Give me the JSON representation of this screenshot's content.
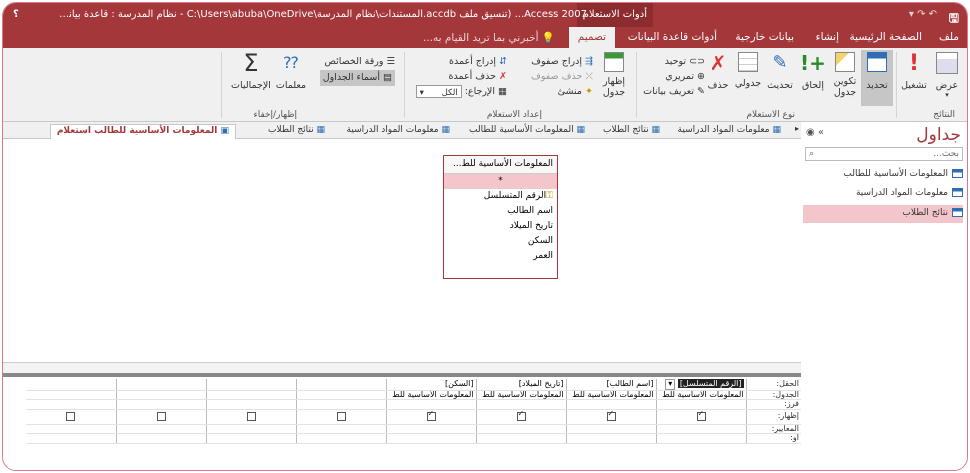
{
  "titlebar": {
    "app_title": "Access 2007... (تنسيق ملف accdb.المستندات\\نظام المدرسة\\C:\\Users\\abuba\\OneDrive - نظام المدرسة : قاعدة بيانات",
    "context_label": "أدوات الاستعلام"
  },
  "tabs": [
    "ملف",
    "الصفحة الرئيسية",
    "إنشاء",
    "بيانات خارجية",
    "أدوات قاعدة البيانات",
    "تصميم"
  ],
  "tell_me": "أخبرني بما تريد القيام به...",
  "ribbon": {
    "results_group": "النتائج",
    "run": "تشغيل",
    "view": "عرض",
    "select": "تحديد",
    "make_table": "تكوين جدول",
    "append": "إلحاق",
    "update": "تحديث",
    "crosstab": "جدولي",
    "delete": "حذف",
    "query_type_group": "نوع الاستعلام",
    "union": "توحيد",
    "pass_through": "تمريري",
    "data_definition": "تعريف بيانات",
    "show_table": "إظهار جدول",
    "setup_group": "إعداد الاستعلام",
    "insert_rows": "إدراج صفوف",
    "delete_rows": "حذف صفوف",
    "builder": "منشئ",
    "insert_columns": "إدراج أعمدة",
    "delete_columns": "حذف أعمدة",
    "return_label": "الإرجاع:",
    "return_value": "الكل",
    "showhide_group": "إظهار/إخفاء",
    "totals": "الإجماليات",
    "parameters": "معلمات",
    "property_sheet": "ورقة الخصائص",
    "table_names": "أسماء الجداول"
  },
  "nav": {
    "header": "جداول",
    "search_placeholder": "بحث...",
    "items": [
      "المعلومات الأساسية للطالب",
      "معلومات المواد الدراسية",
      "نتائج الطلاب"
    ]
  },
  "doc_tabs": [
    "المعلومات الأساسية للطالب استعلام",
    "نتائج الطلاب",
    "معلومات المواد الدراسية",
    "المعلومات الأساسية للطالب",
    "نتائج الطلاب",
    "معلومات المواد الدراسية"
  ],
  "table_box": {
    "title": "المعلومات الأساسية للط...",
    "star": "*",
    "fields": [
      "الرقم المتسلسل",
      "اسم الطالب",
      "تاريخ الميلاد",
      "السكن",
      "العمر"
    ]
  },
  "grid": {
    "row_labels": [
      "الحقل:",
      "الجدول:",
      "فرز:",
      "إظهار:",
      "المعايير:",
      "أو:"
    ],
    "fields": [
      "[الرقم المتسلسل]",
      "[اسم الطالب]",
      "[تاريخ الميلاد]",
      "[السكن]",
      "",
      "",
      "",
      ""
    ],
    "tables": [
      "المعلومات الأساسية للط",
      "المعلومات الأساسية للط",
      "المعلومات الأساسية للط",
      "المعلومات الأساسية للط",
      "",
      "",
      "",
      ""
    ],
    "show": [
      true,
      true,
      true,
      true,
      false,
      false,
      false,
      false
    ],
    "show_visible": [
      true,
      true,
      true,
      true,
      true,
      true,
      true,
      true
    ]
  }
}
